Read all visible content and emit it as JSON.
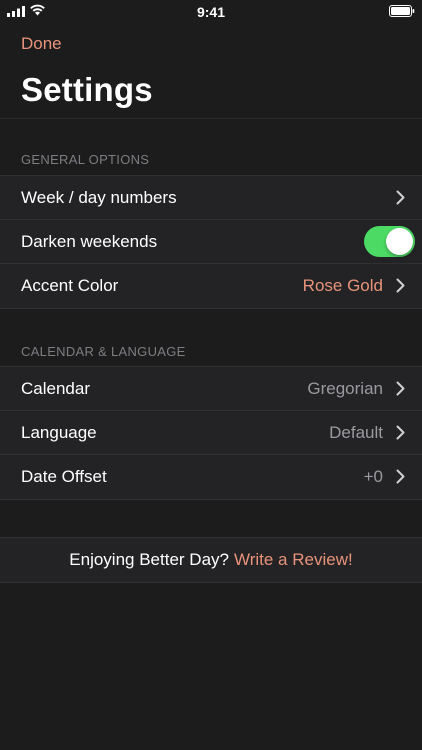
{
  "status_bar": {
    "time": "9:41"
  },
  "header": {
    "done_label": "Done",
    "title": "Settings"
  },
  "sections": [
    {
      "header": "GENERAL OPTIONS",
      "rows": [
        {
          "label": "Week / day numbers",
          "value": ""
        },
        {
          "label": "Darken weekends",
          "toggle_on": true
        },
        {
          "label": "Accent Color",
          "value": "Rose Gold"
        }
      ]
    },
    {
      "header": "CALENDAR & LANGUAGE",
      "rows": [
        {
          "label": "Calendar",
          "value": "Gregorian"
        },
        {
          "label": "Language",
          "value": "Default"
        },
        {
          "label": "Date Offset",
          "value": "+0"
        }
      ]
    }
  ],
  "review": {
    "prompt": "Enjoying Better Day?",
    "link": "Write a Review!"
  },
  "colors": {
    "accent": "#e8937a",
    "toggle_on": "#4cd964",
    "background": "#1c1c1d",
    "cell": "#232325",
    "secondary_text": "#9a9a9f"
  },
  "icons": [
    "signal-icon",
    "wifi-icon",
    "battery-icon",
    "chevron-right-icon"
  ]
}
